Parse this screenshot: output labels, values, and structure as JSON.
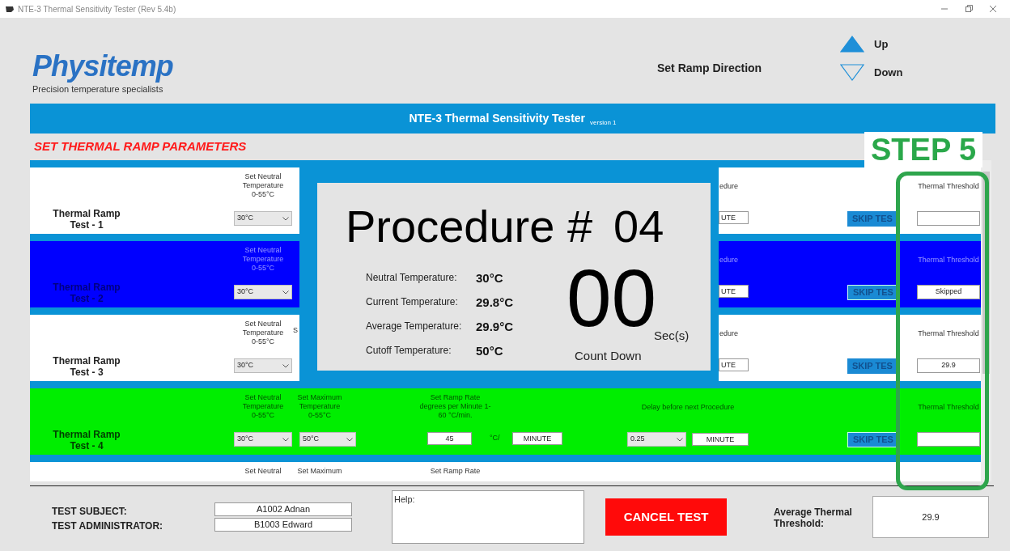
{
  "window": {
    "title": "NTE-3 Thermal Sensitivity Tester (Rev 5.4b)"
  },
  "logo": {
    "name": "Physitemp",
    "tagline": "Precision temperature specialists"
  },
  "ramp_direction": {
    "label": "Set Ramp Direction",
    "options": [
      {
        "label": "Up",
        "selected": true
      },
      {
        "label": "Down",
        "selected": false
      }
    ]
  },
  "banner": {
    "title": "NTE-3 Thermal Sensitivity Tester",
    "version": "version 1"
  },
  "section_title": "SET THERMAL RAMP PARAMETERS",
  "annotation": "STEP 5",
  "rows": [
    {
      "color": "#ffffff",
      "title": "Thermal Ramp",
      "subtitle": "Test - 1",
      "neutral": {
        "label": "Set Neutral Temperature 0-55°C",
        "value": "30°C"
      },
      "delay_tail": {
        "label": "edure",
        "unit": "UTE"
      },
      "skip_button": "SKIP TES",
      "threshold": {
        "label": "Thermal Threshold"
      }
    },
    {
      "color": "#0000ff",
      "title": "Thermal Ramp",
      "subtitle": "Test - 2",
      "neutral": {
        "label": "Set Neutral Temperature 0-55°C",
        "value": "30°C"
      },
      "delay_tail": {
        "label": "edure",
        "unit": "UTE"
      },
      "skip_button": "SKIP TES",
      "threshold": {
        "label": "Thermal Threshold",
        "value": "Skipped"
      }
    },
    {
      "color": "#ffffff",
      "title": "Thermal Ramp",
      "subtitle": "Test - 3",
      "neutral": {
        "label": "Set Neutral Temperature 0-55°C",
        "value": "30°C"
      },
      "maximum_tail": "S",
      "delay_tail": {
        "label": "edure",
        "unit": "UTE"
      },
      "skip_button": "SKIP TES",
      "threshold": {
        "label": "Thermal Threshold",
        "value": "29.9"
      }
    },
    {
      "color": "#00ee00",
      "title": "Thermal Ramp",
      "subtitle": "Test - 4",
      "neutral": {
        "label": "Set Neutral Temperature 0-55°C",
        "value": "30°C"
      },
      "maximum": {
        "label": "Set Maximum Temperature 0-55°C",
        "value": "50°C"
      },
      "ramp": {
        "label": "Set Ramp Rate degrees per Minute 1-60 °C/min.",
        "value": "45",
        "unit": "°C/",
        "per": "MINUTE"
      },
      "delay": {
        "label": "Delay before next Procedure",
        "value": "0.25",
        "unit": "MINUTE"
      },
      "skip_button": "SKIP TES",
      "threshold": {
        "label": "Thermal Threshold"
      }
    },
    {
      "color": "#ffffff",
      "neutral": {
        "label": "Set Neutral"
      },
      "maximum": {
        "label": "Set Maximum"
      },
      "ramp": {
        "label": "Set Ramp Rate"
      }
    }
  ],
  "procedure": {
    "title": "Procedure #",
    "number": "04",
    "readings": [
      {
        "label": "Neutral Temperature:",
        "value": "30°C"
      },
      {
        "label": "Current Temperature:",
        "value": "29.8°C"
      },
      {
        "label": "Average Temperature:",
        "value": "29.9°C"
      },
      {
        "label": "Cutoff Temperature:",
        "value": "50°C"
      }
    ],
    "countdown": "00",
    "countdown_unit": "Sec(s)",
    "countdown_label": "Count Down"
  },
  "footer": {
    "subject_label": "TEST SUBJECT:",
    "subject": "A1002 Adnan",
    "admin_label": "TEST ADMINISTRATOR:",
    "admin": "B1003 Edward",
    "help_placeholder": "Help:",
    "cancel_button": "CANCEL TEST",
    "average_label": "Average Thermal Threshold:",
    "average": "29.9"
  }
}
